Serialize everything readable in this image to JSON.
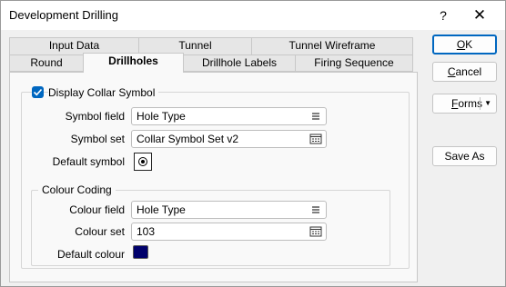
{
  "window": {
    "title": "Development Drilling",
    "help_glyph": "?",
    "close_glyph": "✕"
  },
  "tabs": {
    "back_row": [
      "Input Data",
      "Tunnel",
      "Tunnel Wireframe"
    ],
    "front_row": [
      "Round",
      "Drillholes",
      "Drillhole Labels",
      "Firing Sequence"
    ],
    "active": "Drillholes"
  },
  "collar": {
    "checkbox_label": "Display Collar Symbol",
    "checked": true,
    "symbol_field_label": "Symbol field",
    "symbol_field_value": "Hole Type",
    "symbol_set_label": "Symbol set",
    "symbol_set_value": "Collar Symbol Set v2",
    "default_symbol_label": "Default symbol",
    "colour_group_title": "Colour Coding",
    "colour_field_label": "Colour field",
    "colour_field_value": "Hole Type",
    "colour_set_label": "Colour set",
    "colour_set_value": "103",
    "default_colour_label": "Default colour",
    "default_colour_hex": "#00006b"
  },
  "buttons": {
    "ok_prefix": "",
    "ok_accel": "O",
    "ok_rest": "K",
    "cancel_prefix": "",
    "cancel_accel": "C",
    "cancel_rest": "ancel",
    "forms_prefix": "",
    "forms_accel": "F",
    "forms_rest": "orms",
    "forms_arrow": "▼",
    "save_as": "Save As"
  },
  "icons": {
    "list": "list-icon",
    "browse": "browse-icon",
    "checkmark": "checkmark-icon"
  }
}
